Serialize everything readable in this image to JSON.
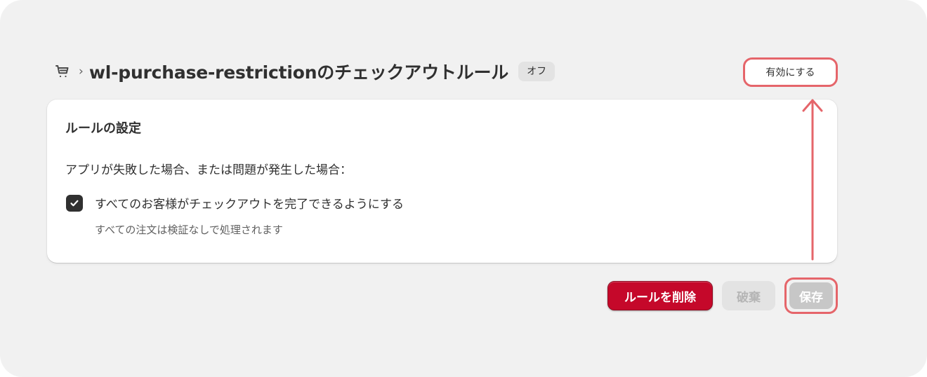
{
  "header": {
    "cart_icon": "cart-icon",
    "chevron": "›",
    "title": "wl-purchase-restrictionのチェックアウトルール",
    "status_badge": "オフ"
  },
  "actions": {
    "enable_label": "有効にする",
    "delete_label": "ルールを削除",
    "discard_label": "破棄",
    "save_label": "保存"
  },
  "card": {
    "title": "ルールの設定",
    "description": "アプリが失敗した場合、または問題が発生した場合：",
    "checkbox": {
      "checked": true,
      "label": "すべてのお客様がチェックアウトを完了できるようにする",
      "help": "すべての注文は検証なしで処理されます"
    }
  },
  "colors": {
    "background": "#f1f1f1",
    "highlight": "#e5656a",
    "delete": "#c5082a"
  }
}
